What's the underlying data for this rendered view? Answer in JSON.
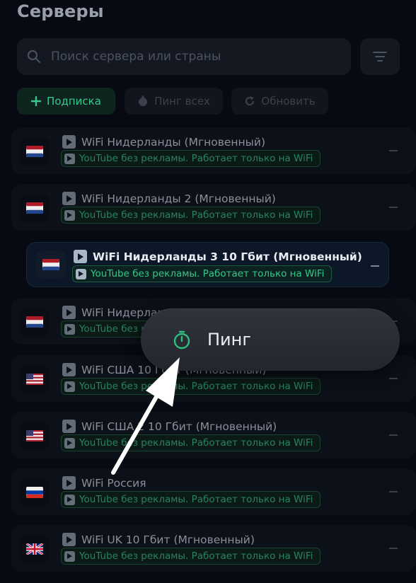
{
  "header": {
    "title": "Серверы"
  },
  "search": {
    "placeholder": "Поиск сервера или страны",
    "value": ""
  },
  "toolbar": {
    "subscription_label": "Подписка",
    "ping_all_label": "Пинг всех",
    "refresh_label": "Обновить"
  },
  "servers": [
    {
      "name": "WiFi Нидерланды (Мгновенный)",
      "flag": "netherlands-flag",
      "badge": "YouTube без рекламы. Работает только на WiFi"
    },
    {
      "name": "WiFi Нидерланды 2 (Мгновенный)",
      "flag": "netherlands-flag",
      "badge": "YouTube без рекламы. Работает только на WiFi"
    },
    {
      "name": "WiFi Нидерланды 3 10 Гбит (Мгновенный)",
      "flag": "netherlands-flag",
      "badge": "YouTube без рекламы. Работает только на WiFi",
      "selected": true
    },
    {
      "name": "WiFi Нидерланды 4",
      "flag": "netherlands-flag",
      "badge": "YouTube без рекламы. Работает только на WiFi"
    },
    {
      "name": "WiFi США 10 Гбит (Мгновенный)",
      "flag": "usa-flag",
      "badge": "YouTube без рекламы. Работает только на WiFi"
    },
    {
      "name": "WiFi США 2 10 Гбит (Мгновенный)",
      "flag": "usa-flag",
      "badge": "YouTube без рекламы. Работает только на WiFi"
    },
    {
      "name": "WiFi Россия",
      "flag": "russia-flag",
      "badge": "YouTube без рекламы. Работает только на WiFi"
    },
    {
      "name": "WiFi UK 10 Гбит (Мгновенный)",
      "flag": "uk-flag",
      "badge": "YouTube без рекламы. Работает только на WiFi"
    }
  ],
  "context_menu": {
    "ping_label": "Пинг",
    "icon": "stopwatch-icon"
  },
  "colors": {
    "accent": "#37c98c",
    "background": "#070a12",
    "selected_row": "#0c1828"
  }
}
